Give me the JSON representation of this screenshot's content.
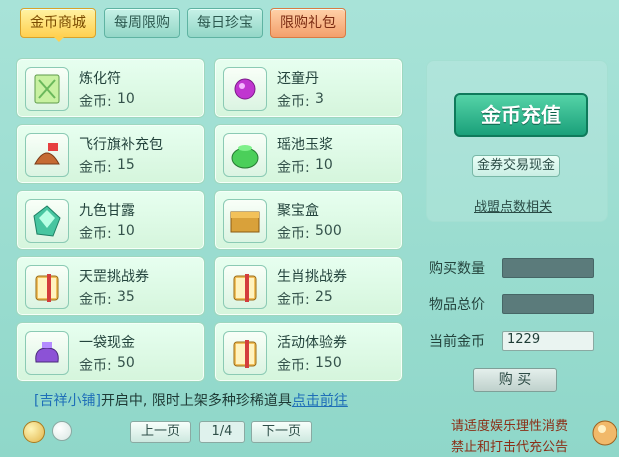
{
  "tabs": [
    {
      "label": "金币商城"
    },
    {
      "label": "每周限购"
    },
    {
      "label": "每日珍宝"
    },
    {
      "label": "限购礼包"
    }
  ],
  "items": [
    {
      "name": "炼化符",
      "price_label": "金币:",
      "price": "10",
      "icon": "talisman-icon"
    },
    {
      "name": "还童丹",
      "price_label": "金币:",
      "price": "3",
      "icon": "purple-pill-icon"
    },
    {
      "name": "飞行旗补充包",
      "price_label": "金币:",
      "price": "15",
      "icon": "flag-bag-icon"
    },
    {
      "name": "瑶池玉浆",
      "price_label": "金币:",
      "price": "10",
      "icon": "jade-jar-icon"
    },
    {
      "name": "九色甘露",
      "price_label": "金币:",
      "price": "10",
      "icon": "crystal-dew-icon"
    },
    {
      "name": "聚宝盒",
      "price_label": "金币:",
      "price": "500",
      "icon": "treasure-box-icon"
    },
    {
      "name": "天罡挑战券",
      "price_label": "金币:",
      "price": "35",
      "icon": "scroll-ticket-icon"
    },
    {
      "name": "生肖挑战券",
      "price_label": "金币:",
      "price": "25",
      "icon": "scroll-ticket-icon"
    },
    {
      "name": "一袋现金",
      "price_label": "金币:",
      "price": "50",
      "icon": "money-bag-icon"
    },
    {
      "name": "活动体验券",
      "price_label": "金币:",
      "price": "150",
      "icon": "scroll-ticket-icon"
    }
  ],
  "notice": {
    "tag": "[吉祥小铺]",
    "text": "开启中, 限时上架多种珍稀道具",
    "link": "点击前往"
  },
  "pager": {
    "prev": "上一页",
    "indicator": "1/4",
    "next": "下一页"
  },
  "right": {
    "recharge": "金币充值",
    "exchange": "金券交易现金",
    "alliance": "战盟点数相关",
    "qty_label": "购买数量",
    "total_label": "物品总价",
    "current_label": "当前金币",
    "current_value": "1229",
    "buy": "购 买"
  },
  "disclaimer": {
    "line1": "请适度娱乐理性消费",
    "line2": "禁止和打击代充公告"
  },
  "colors": {
    "accent": "#1aa07a",
    "tab_active": "#ffd04f",
    "tab_red": "#f3a06c"
  }
}
